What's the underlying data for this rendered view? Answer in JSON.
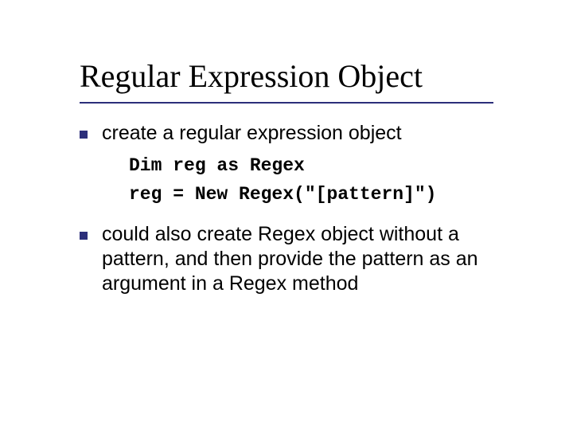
{
  "slide": {
    "title": "Regular Expression Object",
    "bullets": [
      {
        "text": "create a regular expression object",
        "code": "Dim reg as Regex\nreg = New Regex(\"[pattern]\")"
      },
      {
        "text": "could also create Regex object without a pattern, and then provide the pattern as an argument in a Regex method"
      }
    ]
  }
}
